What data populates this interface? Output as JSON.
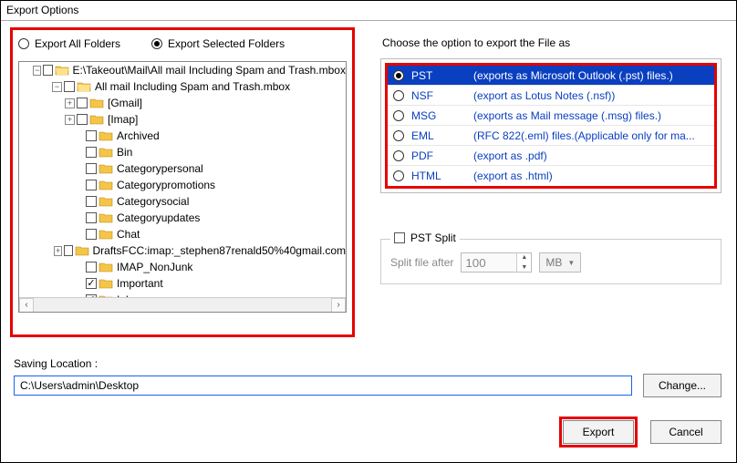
{
  "window": {
    "title": "Export Options"
  },
  "radios": {
    "all": "Export All Folders",
    "selected": "Export Selected Folders",
    "checked": "selected"
  },
  "tree": {
    "root_label": "E:\\Takeout\\Mail\\All mail Including Spam and Trash.mbox",
    "child_label": "All mail Including Spam and Trash.mbox",
    "items": [
      {
        "label": "[Gmail]",
        "expandable": true,
        "checked": false
      },
      {
        "label": "[Imap]",
        "expandable": true,
        "checked": false
      },
      {
        "label": "Archived",
        "expandable": false,
        "checked": false
      },
      {
        "label": "Bin",
        "expandable": false,
        "checked": false
      },
      {
        "label": "Categorypersonal",
        "expandable": false,
        "checked": false
      },
      {
        "label": "Categorypromotions",
        "expandable": false,
        "checked": false
      },
      {
        "label": "Categorysocial",
        "expandable": false,
        "checked": false
      },
      {
        "label": "Categoryupdates",
        "expandable": false,
        "checked": false
      },
      {
        "label": "Chat",
        "expandable": false,
        "checked": false
      },
      {
        "label": "DraftsFCC:imap:_stephen87renald50%40gmail.com",
        "expandable": true,
        "checked": false
      },
      {
        "label": "IMAP_NonJunk",
        "expandable": false,
        "checked": false
      },
      {
        "label": "Important",
        "expandable": false,
        "checked": true
      },
      {
        "label": "Inbox",
        "expandable": false,
        "checked": true
      }
    ]
  },
  "right": {
    "choose_label": "Choose the option to export the File as",
    "formats": [
      {
        "code": "PST",
        "desc": "(exports as Microsoft Outlook (.pst) files.)",
        "selected": true
      },
      {
        "code": "NSF",
        "desc": "(export as Lotus Notes (.nsf))",
        "selected": false
      },
      {
        "code": "MSG",
        "desc": "(exports as Mail message (.msg) files.)",
        "selected": false
      },
      {
        "code": "EML",
        "desc": "(RFC 822(.eml) files.(Applicable only for ma...",
        "selected": false
      },
      {
        "code": "PDF",
        "desc": "(export as .pdf)",
        "selected": false
      },
      {
        "code": "HTML",
        "desc": "(export as .html)",
        "selected": false
      }
    ],
    "split": {
      "title": "PST Split",
      "checked": false,
      "after_label": "Split file after",
      "value": "100",
      "unit": "MB"
    }
  },
  "saving": {
    "label": "Saving Location :",
    "path": "C:\\Users\\admin\\Desktop",
    "change_btn": "Change..."
  },
  "buttons": {
    "export": "Export",
    "cancel": "Cancel"
  }
}
